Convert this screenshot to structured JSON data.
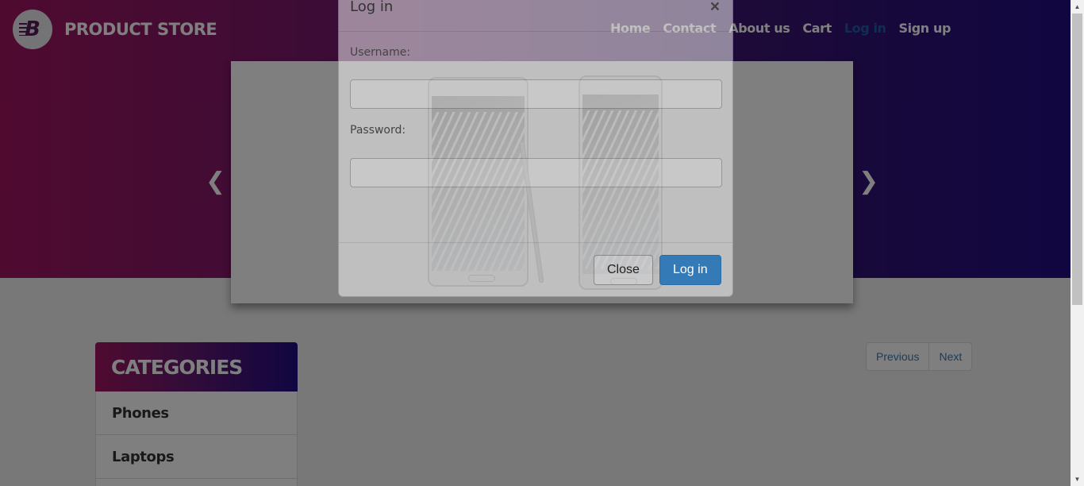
{
  "brand": {
    "logo_letter": "B",
    "name": "PRODUCT STORE"
  },
  "nav": {
    "items": [
      {
        "label": "Home"
      },
      {
        "label": "Contact"
      },
      {
        "label": "About us"
      },
      {
        "label": "Cart"
      },
      {
        "label": "Log in"
      },
      {
        "label": "Sign up"
      }
    ],
    "active": "Log in",
    "active_color": "#1c5ea8"
  },
  "carousel": {
    "prev_icon": "chevron-left-icon",
    "next_icon": "chevron-right-icon",
    "prev_glyph": "❮",
    "next_glyph": "❯"
  },
  "categories": {
    "title": "CATEGORIES",
    "items": [
      {
        "label": "Phones"
      },
      {
        "label": "Laptops"
      }
    ]
  },
  "pager": {
    "previous": "Previous",
    "next": "Next"
  },
  "modal": {
    "title": "Log in",
    "close_glyph": "×",
    "username_label": "Username:",
    "username_value": "",
    "password_label": "Password:",
    "password_value": "",
    "close_button": "Close",
    "login_button": "Log in"
  },
  "colors": {
    "gradient_start": "#a01560",
    "gradient_end": "#210d82",
    "primary": "#337ab7"
  }
}
